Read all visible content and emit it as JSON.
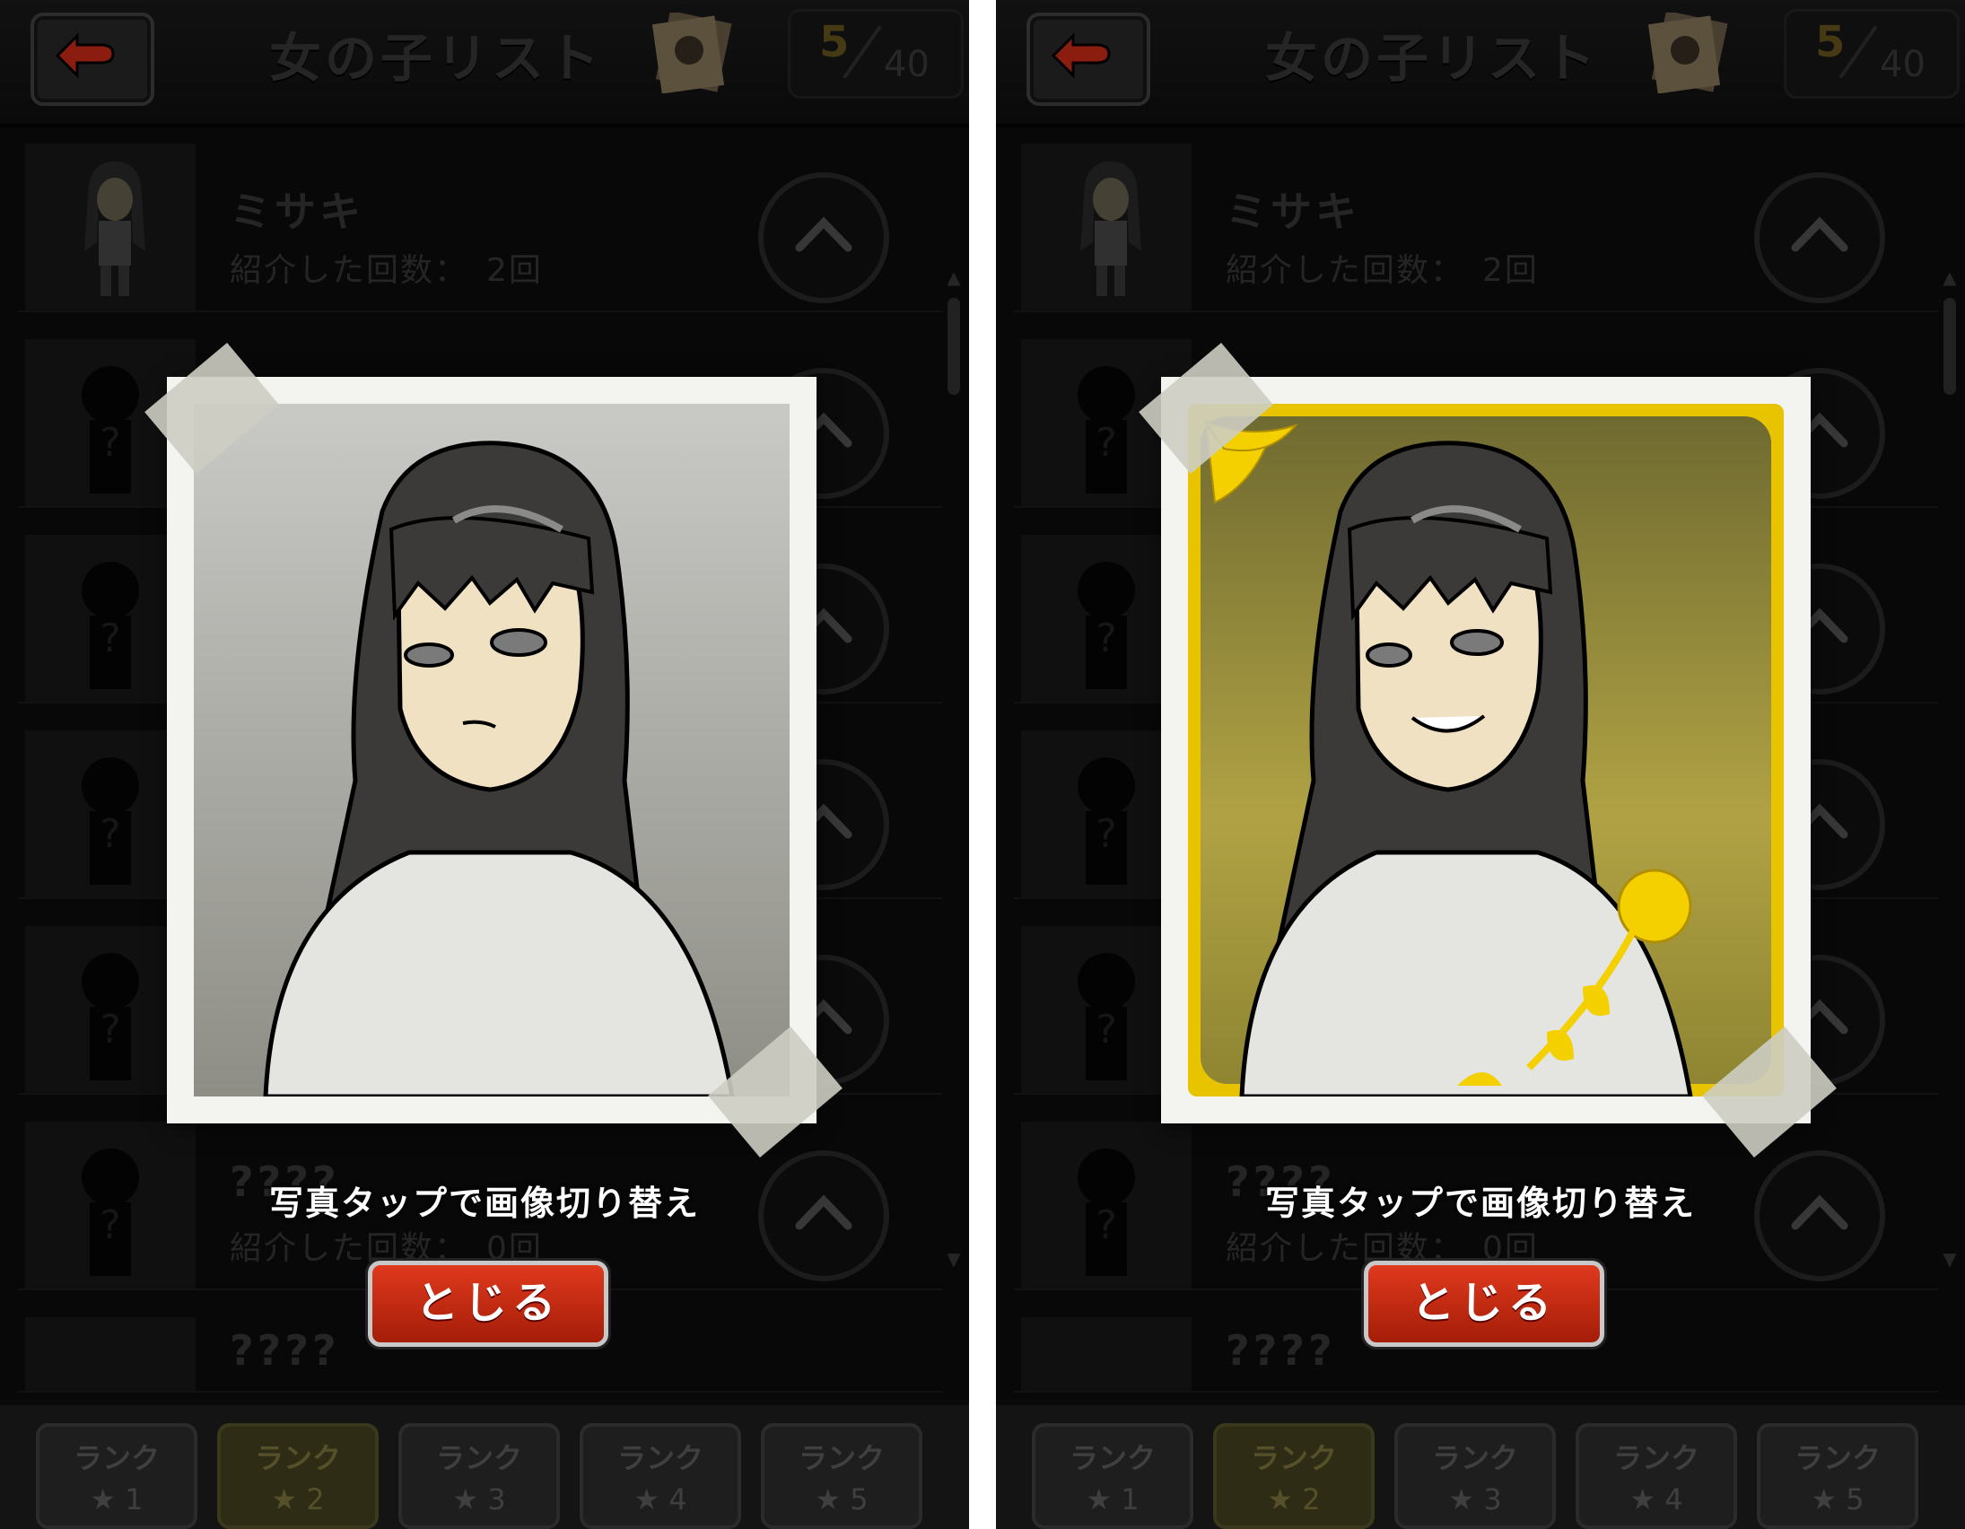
{
  "header": {
    "title": "女の子リスト",
    "count_current": "5",
    "count_max": "40"
  },
  "list": {
    "rows": [
      {
        "name": "ミサキ",
        "count_text": "紹介した回数：　2回",
        "state": "known"
      },
      {
        "name": "????",
        "count_text": "紹介した回数：　0回",
        "state": "unknown"
      },
      {
        "name": "????",
        "count_text": "",
        "state": "unknown"
      }
    ]
  },
  "overlay": {
    "hint": "写真タップで画像切り替え",
    "close_label": "とじる"
  },
  "footer": {
    "tabs": [
      {
        "label": "ランク",
        "star": "★ 1",
        "active": false
      },
      {
        "label": "ランク",
        "star": "★ 2",
        "active": true
      },
      {
        "label": "ランク",
        "star": "★ 3",
        "active": false
      },
      {
        "label": "ランク",
        "star": "★ 4",
        "active": false
      },
      {
        "label": "ランク",
        "star": "★ 5",
        "active": false
      }
    ]
  },
  "panels": [
    {
      "photo_style": "normal",
      "frame_color": "#f3f3f0"
    },
    {
      "photo_style": "gold",
      "frame_color": "#e8c400"
    }
  ],
  "colors": {
    "background": "#0d0d0d",
    "close_button": "#d2331a",
    "gold_frame": "#e8c400",
    "gold_bg": "#8f8532"
  }
}
